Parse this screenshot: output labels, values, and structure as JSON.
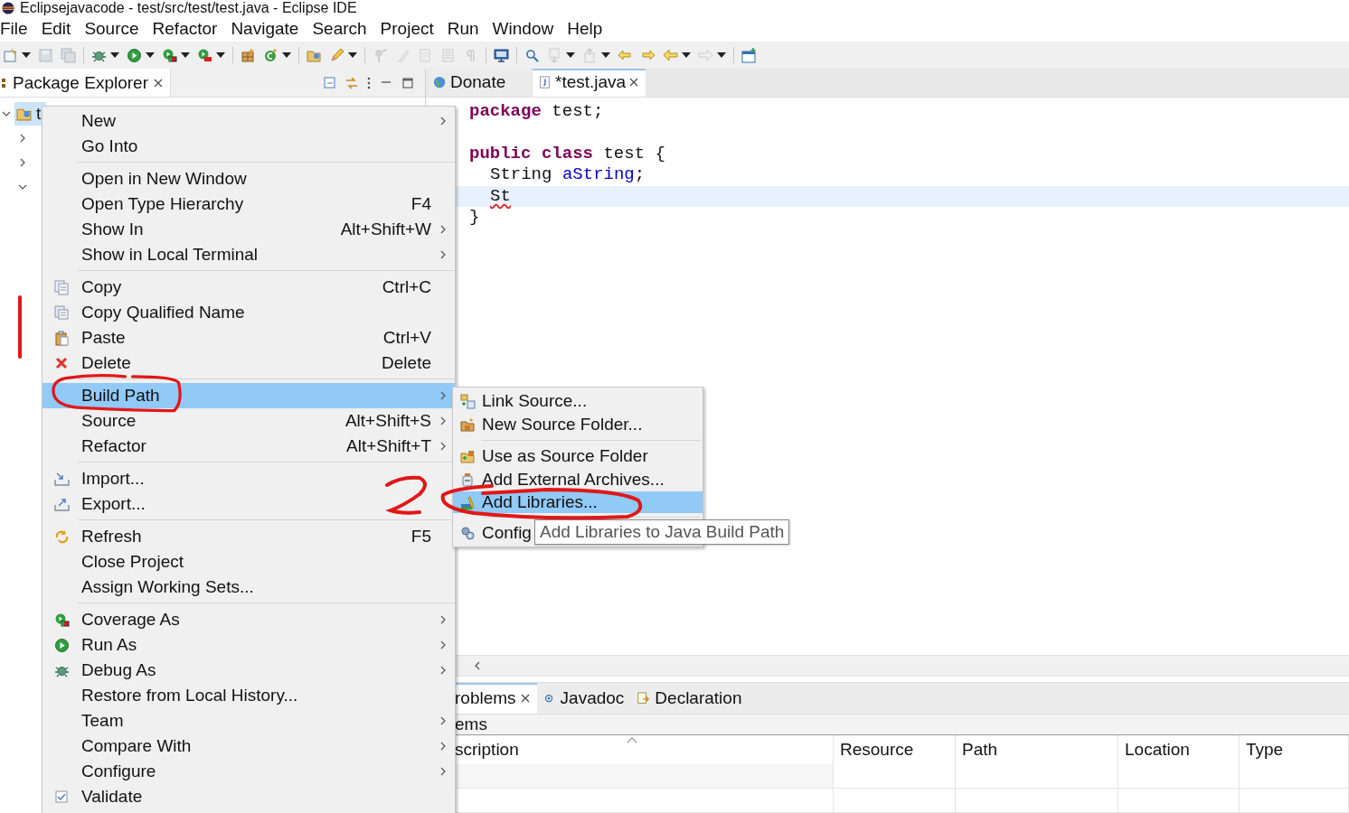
{
  "window": {
    "title": "Eclipsejavacode - test/src/test/test.java - Eclipse IDE"
  },
  "menubar": [
    "File",
    "Edit",
    "Source",
    "Refactor",
    "Navigate",
    "Search",
    "Project",
    "Run",
    "Window",
    "Help"
  ],
  "toolbar": [
    {
      "kind": "button",
      "dropdown": true,
      "disabled": false
    },
    {
      "kind": "button",
      "dropdown": false,
      "disabled": true
    },
    {
      "kind": "button",
      "dropdown": false,
      "disabled": true
    },
    {
      "kind": "separator"
    },
    {
      "kind": "button",
      "dropdown": true,
      "disabled": false
    },
    {
      "kind": "button",
      "dropdown": true,
      "disabled": false
    },
    {
      "kind": "button",
      "dropdown": true,
      "disabled": false
    },
    {
      "kind": "button",
      "dropdown": true,
      "disabled": false
    },
    {
      "kind": "separator"
    },
    {
      "kind": "button",
      "dropdown": false,
      "disabled": false
    },
    {
      "kind": "button",
      "dropdown": true,
      "disabled": false
    },
    {
      "kind": "separator"
    },
    {
      "kind": "button",
      "dropdown": false,
      "disabled": false
    },
    {
      "kind": "button",
      "dropdown": true,
      "disabled": false
    },
    {
      "kind": "separator"
    },
    {
      "kind": "button",
      "dropdown": false,
      "disabled": true
    },
    {
      "kind": "button",
      "dropdown": false,
      "disabled": true
    },
    {
      "kind": "button",
      "dropdown": false,
      "disabled": true
    },
    {
      "kind": "button",
      "dropdown": false,
      "disabled": true
    },
    {
      "kind": "button",
      "dropdown": false,
      "disabled": true
    },
    {
      "kind": "separator"
    },
    {
      "kind": "button",
      "dropdown": false,
      "disabled": false
    },
    {
      "kind": "separator"
    },
    {
      "kind": "button",
      "dropdown": false,
      "disabled": false
    },
    {
      "kind": "button",
      "dropdown": true,
      "disabled": true
    },
    {
      "kind": "button",
      "dropdown": true,
      "disabled": true
    },
    {
      "kind": "button",
      "dropdown": false,
      "disabled": false
    },
    {
      "kind": "button",
      "dropdown": false,
      "disabled": false
    },
    {
      "kind": "button",
      "dropdown": true,
      "disabled": false
    },
    {
      "kind": "button",
      "dropdown": true,
      "disabled": true
    },
    {
      "kind": "separator"
    },
    {
      "kind": "button",
      "dropdown": false,
      "disabled": false
    }
  ],
  "package_explorer": {
    "title": "Package Explorer",
    "tree": [
      {
        "label": "t",
        "selected": true,
        "expanded": true,
        "children": [
          {
            "expanded": false
          },
          {
            "expanded": false
          },
          {
            "expanded": true
          }
        ]
      }
    ]
  },
  "editor": {
    "tabs": [
      {
        "label": "Donate",
        "selected": false,
        "closable": false
      },
      {
        "label": "*test.java",
        "selected": true,
        "closable": true
      }
    ],
    "lines": [
      {
        "current": false,
        "indented": false,
        "words": [
          [
            {
              "t": "package",
              "kind": "keyword"
            }
          ],
          [
            {
              "t": "test;",
              "kind": "plain"
            }
          ]
        ]
      },
      {
        "current": false,
        "indented": false
      },
      {
        "current": false,
        "indented": false,
        "words": [
          [
            {
              "t": "public",
              "kind": "keyword"
            }
          ],
          [
            {
              "t": "class",
              "kind": "keyword"
            }
          ],
          [
            {
              "t": "test {",
              "kind": "plain"
            }
          ]
        ]
      },
      {
        "current": false,
        "indented": true,
        "words": [
          [
            {
              "t": "String",
              "kind": "plain"
            }
          ],
          [
            {
              "t": "aString",
              "kind": "field"
            },
            {
              "t": ";",
              "kind": "plain"
            }
          ]
        ]
      },
      {
        "current": true,
        "indented": true,
        "words": [
          [
            {
              "t": "St",
              "kind": "error"
            }
          ]
        ]
      },
      {
        "current": false,
        "indented": false,
        "words": [
          [
            {
              "t": "}",
              "kind": "plain"
            }
          ]
        ]
      }
    ]
  },
  "bottom_panel": {
    "tabs": [
      {
        "label": "roblems",
        "selected": true,
        "closable": true
      },
      {
        "label": "Javadoc",
        "selected": false,
        "closable": false
      },
      {
        "label": "Declaration",
        "selected": false,
        "closable": false
      }
    ],
    "summary": "ems",
    "columns": [
      {
        "label": "scription",
        "sorted": true
      },
      {
        "label": "Resource",
        "sorted": false
      },
      {
        "label": "Path",
        "sorted": false
      },
      {
        "label": "Location",
        "sorted": false
      },
      {
        "label": "Type",
        "sorted": false
      }
    ]
  },
  "context_menu": {
    "items": [
      {
        "kind": "item",
        "label": "New",
        "submenu": true,
        "selected": false
      },
      {
        "kind": "item",
        "label": "Go Into",
        "submenu": false,
        "selected": false
      },
      {
        "kind": "separator"
      },
      {
        "kind": "item",
        "label": "Open in New Window",
        "submenu": false,
        "selected": false
      },
      {
        "kind": "item",
        "label": "Open Type Hierarchy",
        "shortcut": "F4",
        "submenu": false,
        "selected": false
      },
      {
        "kind": "item",
        "label": "Show In",
        "shortcut": "Alt+Shift+W",
        "submenu": true,
        "selected": false
      },
      {
        "kind": "item",
        "label": "Show in Local Terminal",
        "submenu": true,
        "selected": false
      },
      {
        "kind": "separator"
      },
      {
        "kind": "item",
        "label": "Copy",
        "shortcut": "Ctrl+C",
        "submenu": false,
        "selected": false
      },
      {
        "kind": "item",
        "label": "Copy Qualified Name",
        "submenu": false,
        "selected": false
      },
      {
        "kind": "item",
        "label": "Paste",
        "shortcut": "Ctrl+V",
        "submenu": false,
        "selected": false
      },
      {
        "kind": "item",
        "label": "Delete",
        "shortcut": "Delete",
        "submenu": false,
        "selected": false
      },
      {
        "kind": "separator"
      },
      {
        "kind": "item",
        "label": "Build Path",
        "submenu": true,
        "selected": true
      },
      {
        "kind": "item",
        "label": "Source",
        "shortcut": "Alt+Shift+S",
        "submenu": true,
        "selected": false
      },
      {
        "kind": "item",
        "label": "Refactor",
        "shortcut": "Alt+Shift+T",
        "submenu": true,
        "selected": false
      },
      {
        "kind": "separator"
      },
      {
        "kind": "item",
        "label": "Import...",
        "submenu": false,
        "selected": false
      },
      {
        "kind": "item",
        "label": "Export...",
        "submenu": false,
        "selected": false
      },
      {
        "kind": "separator"
      },
      {
        "kind": "item",
        "label": "Refresh",
        "shortcut": "F5",
        "submenu": false,
        "selected": false
      },
      {
        "kind": "item",
        "label": "Close Project",
        "submenu": false,
        "selected": false
      },
      {
        "kind": "item",
        "label": "Assign Working Sets...",
        "submenu": false,
        "selected": false
      },
      {
        "kind": "separator"
      },
      {
        "kind": "item",
        "label": "Coverage As",
        "submenu": true,
        "selected": false
      },
      {
        "kind": "item",
        "label": "Run As",
        "submenu": true,
        "selected": false
      },
      {
        "kind": "item",
        "label": "Debug As",
        "submenu": true,
        "selected": false
      },
      {
        "kind": "item",
        "label": "Restore from Local History...",
        "submenu": false,
        "selected": false
      },
      {
        "kind": "item",
        "label": "Team",
        "submenu": true,
        "selected": false
      },
      {
        "kind": "item",
        "label": "Compare With",
        "submenu": true,
        "selected": false
      },
      {
        "kind": "item",
        "label": "Configure",
        "submenu": true,
        "selected": false
      },
      {
        "kind": "item",
        "label": "Validate",
        "submenu": false,
        "selected": false
      }
    ]
  },
  "submenu": {
    "items": [
      {
        "kind": "item",
        "label": "Link Source...",
        "selected": false
      },
      {
        "kind": "item",
        "label": "New Source Folder...",
        "selected": false
      },
      {
        "kind": "separator"
      },
      {
        "kind": "item",
        "label": "Use as Source Folder",
        "selected": false
      },
      {
        "kind": "item",
        "label": "Add External Archives...",
        "selected": false
      },
      {
        "kind": "item",
        "label": "Add Libraries...",
        "selected": true
      },
      {
        "kind": "separator"
      },
      {
        "kind": "item",
        "label": "Config",
        "selected": false
      }
    ]
  },
  "tooltip": {
    "text": "Add Libraries to Java Build Path"
  }
}
